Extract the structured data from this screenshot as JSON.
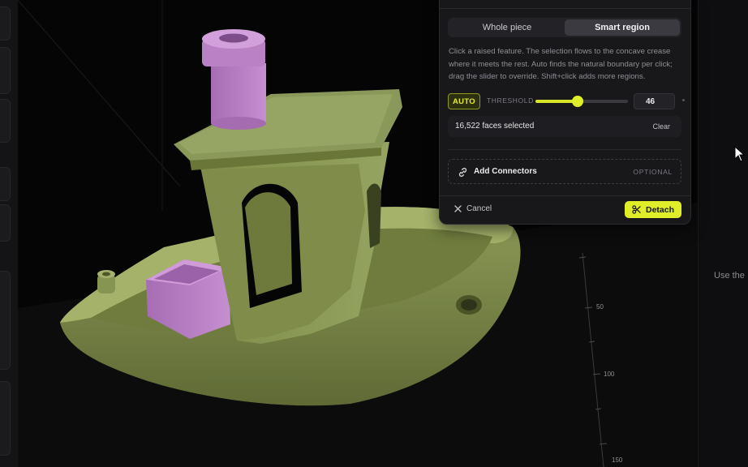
{
  "mode_tabs": [
    {
      "label": "Whole piece",
      "active": false
    },
    {
      "label": "Smart region",
      "active": true
    }
  ],
  "description": "Click a raised feature. The selection flows to the concave crease where it meets the rest. Auto finds the natural boundary per click; drag the slider to override. Shift+click adds more regions.",
  "threshold": {
    "auto_label": "AUTO",
    "label": "THRESHOLD",
    "value": "46",
    "slider_fraction": 0.46
  },
  "selection": {
    "faces_text": "16,522 faces selected",
    "clear_label": "Clear"
  },
  "connectors": {
    "label": "Add Connectors",
    "tag": "OPTIONAL"
  },
  "footer": {
    "cancel_label": "Cancel",
    "detach_label": "Detach"
  },
  "axis_ticks": [
    "50",
    "100",
    "150"
  ],
  "right_hint": "Use the",
  "icons": {
    "cancel": "close-icon",
    "detach": "scissors-icon",
    "connectors": "link-icon",
    "cursor": "mouse-pointer-icon"
  },
  "colors": {
    "accent": "#dfee29",
    "model_green": "#8b9a55",
    "selection_pink": "#b87ec4",
    "panel_bg": "#18181b"
  }
}
